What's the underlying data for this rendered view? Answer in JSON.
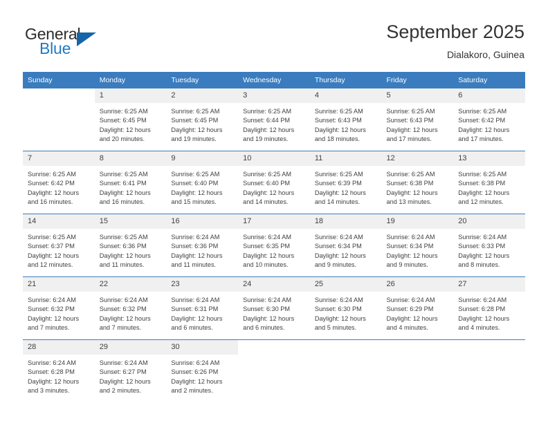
{
  "brand": {
    "name_part1": "General",
    "name_part2": "Blue",
    "triangle_color": "#1565a8",
    "blue_color": "#1f7ac4"
  },
  "header": {
    "title": "September 2025",
    "subtitle": "Dialakoro, Guinea"
  },
  "theme": {
    "header_bg": "#3a7cbe",
    "daynum_bg": "#f0f0f0",
    "text": "#3f3f3f"
  },
  "calendar": {
    "weekday_headers": [
      "Sunday",
      "Monday",
      "Tuesday",
      "Wednesday",
      "Thursday",
      "Friday",
      "Saturday"
    ],
    "weeks": [
      [
        {
          "day": "",
          "empty": true,
          "sunrise": "",
          "sunset": "",
          "daylight_line1": "",
          "daylight_line2": ""
        },
        {
          "day": "1",
          "empty": false,
          "sunrise": "Sunrise: 6:25 AM",
          "sunset": "Sunset: 6:45 PM",
          "daylight_line1": "Daylight: 12 hours",
          "daylight_line2": "and 20 minutes."
        },
        {
          "day": "2",
          "empty": false,
          "sunrise": "Sunrise: 6:25 AM",
          "sunset": "Sunset: 6:45 PM",
          "daylight_line1": "Daylight: 12 hours",
          "daylight_line2": "and 19 minutes."
        },
        {
          "day": "3",
          "empty": false,
          "sunrise": "Sunrise: 6:25 AM",
          "sunset": "Sunset: 6:44 PM",
          "daylight_line1": "Daylight: 12 hours",
          "daylight_line2": "and 19 minutes."
        },
        {
          "day": "4",
          "empty": false,
          "sunrise": "Sunrise: 6:25 AM",
          "sunset": "Sunset: 6:43 PM",
          "daylight_line1": "Daylight: 12 hours",
          "daylight_line2": "and 18 minutes."
        },
        {
          "day": "5",
          "empty": false,
          "sunrise": "Sunrise: 6:25 AM",
          "sunset": "Sunset: 6:43 PM",
          "daylight_line1": "Daylight: 12 hours",
          "daylight_line2": "and 17 minutes."
        },
        {
          "day": "6",
          "empty": false,
          "sunrise": "Sunrise: 6:25 AM",
          "sunset": "Sunset: 6:42 PM",
          "daylight_line1": "Daylight: 12 hours",
          "daylight_line2": "and 17 minutes."
        }
      ],
      [
        {
          "day": "7",
          "empty": false,
          "sunrise": "Sunrise: 6:25 AM",
          "sunset": "Sunset: 6:42 PM",
          "daylight_line1": "Daylight: 12 hours",
          "daylight_line2": "and 16 minutes."
        },
        {
          "day": "8",
          "empty": false,
          "sunrise": "Sunrise: 6:25 AM",
          "sunset": "Sunset: 6:41 PM",
          "daylight_line1": "Daylight: 12 hours",
          "daylight_line2": "and 16 minutes."
        },
        {
          "day": "9",
          "empty": false,
          "sunrise": "Sunrise: 6:25 AM",
          "sunset": "Sunset: 6:40 PM",
          "daylight_line1": "Daylight: 12 hours",
          "daylight_line2": "and 15 minutes."
        },
        {
          "day": "10",
          "empty": false,
          "sunrise": "Sunrise: 6:25 AM",
          "sunset": "Sunset: 6:40 PM",
          "daylight_line1": "Daylight: 12 hours",
          "daylight_line2": "and 14 minutes."
        },
        {
          "day": "11",
          "empty": false,
          "sunrise": "Sunrise: 6:25 AM",
          "sunset": "Sunset: 6:39 PM",
          "daylight_line1": "Daylight: 12 hours",
          "daylight_line2": "and 14 minutes."
        },
        {
          "day": "12",
          "empty": false,
          "sunrise": "Sunrise: 6:25 AM",
          "sunset": "Sunset: 6:38 PM",
          "daylight_line1": "Daylight: 12 hours",
          "daylight_line2": "and 13 minutes."
        },
        {
          "day": "13",
          "empty": false,
          "sunrise": "Sunrise: 6:25 AM",
          "sunset": "Sunset: 6:38 PM",
          "daylight_line1": "Daylight: 12 hours",
          "daylight_line2": "and 12 minutes."
        }
      ],
      [
        {
          "day": "14",
          "empty": false,
          "sunrise": "Sunrise: 6:25 AM",
          "sunset": "Sunset: 6:37 PM",
          "daylight_line1": "Daylight: 12 hours",
          "daylight_line2": "and 12 minutes."
        },
        {
          "day": "15",
          "empty": false,
          "sunrise": "Sunrise: 6:25 AM",
          "sunset": "Sunset: 6:36 PM",
          "daylight_line1": "Daylight: 12 hours",
          "daylight_line2": "and 11 minutes."
        },
        {
          "day": "16",
          "empty": false,
          "sunrise": "Sunrise: 6:24 AM",
          "sunset": "Sunset: 6:36 PM",
          "daylight_line1": "Daylight: 12 hours",
          "daylight_line2": "and 11 minutes."
        },
        {
          "day": "17",
          "empty": false,
          "sunrise": "Sunrise: 6:24 AM",
          "sunset": "Sunset: 6:35 PM",
          "daylight_line1": "Daylight: 12 hours",
          "daylight_line2": "and 10 minutes."
        },
        {
          "day": "18",
          "empty": false,
          "sunrise": "Sunrise: 6:24 AM",
          "sunset": "Sunset: 6:34 PM",
          "daylight_line1": "Daylight: 12 hours",
          "daylight_line2": "and 9 minutes."
        },
        {
          "day": "19",
          "empty": false,
          "sunrise": "Sunrise: 6:24 AM",
          "sunset": "Sunset: 6:34 PM",
          "daylight_line1": "Daylight: 12 hours",
          "daylight_line2": "and 9 minutes."
        },
        {
          "day": "20",
          "empty": false,
          "sunrise": "Sunrise: 6:24 AM",
          "sunset": "Sunset: 6:33 PM",
          "daylight_line1": "Daylight: 12 hours",
          "daylight_line2": "and 8 minutes."
        }
      ],
      [
        {
          "day": "21",
          "empty": false,
          "sunrise": "Sunrise: 6:24 AM",
          "sunset": "Sunset: 6:32 PM",
          "daylight_line1": "Daylight: 12 hours",
          "daylight_line2": "and 7 minutes."
        },
        {
          "day": "22",
          "empty": false,
          "sunrise": "Sunrise: 6:24 AM",
          "sunset": "Sunset: 6:32 PM",
          "daylight_line1": "Daylight: 12 hours",
          "daylight_line2": "and 7 minutes."
        },
        {
          "day": "23",
          "empty": false,
          "sunrise": "Sunrise: 6:24 AM",
          "sunset": "Sunset: 6:31 PM",
          "daylight_line1": "Daylight: 12 hours",
          "daylight_line2": "and 6 minutes."
        },
        {
          "day": "24",
          "empty": false,
          "sunrise": "Sunrise: 6:24 AM",
          "sunset": "Sunset: 6:30 PM",
          "daylight_line1": "Daylight: 12 hours",
          "daylight_line2": "and 6 minutes."
        },
        {
          "day": "25",
          "empty": false,
          "sunrise": "Sunrise: 6:24 AM",
          "sunset": "Sunset: 6:30 PM",
          "daylight_line1": "Daylight: 12 hours",
          "daylight_line2": "and 5 minutes."
        },
        {
          "day": "26",
          "empty": false,
          "sunrise": "Sunrise: 6:24 AM",
          "sunset": "Sunset: 6:29 PM",
          "daylight_line1": "Daylight: 12 hours",
          "daylight_line2": "and 4 minutes."
        },
        {
          "day": "27",
          "empty": false,
          "sunrise": "Sunrise: 6:24 AM",
          "sunset": "Sunset: 6:28 PM",
          "daylight_line1": "Daylight: 12 hours",
          "daylight_line2": "and 4 minutes."
        }
      ],
      [
        {
          "day": "28",
          "empty": false,
          "sunrise": "Sunrise: 6:24 AM",
          "sunset": "Sunset: 6:28 PM",
          "daylight_line1": "Daylight: 12 hours",
          "daylight_line2": "and 3 minutes."
        },
        {
          "day": "29",
          "empty": false,
          "sunrise": "Sunrise: 6:24 AM",
          "sunset": "Sunset: 6:27 PM",
          "daylight_line1": "Daylight: 12 hours",
          "daylight_line2": "and 2 minutes."
        },
        {
          "day": "30",
          "empty": false,
          "sunrise": "Sunrise: 6:24 AM",
          "sunset": "Sunset: 6:26 PM",
          "daylight_line1": "Daylight: 12 hours",
          "daylight_line2": "and 2 minutes."
        },
        {
          "day": "",
          "empty": true,
          "sunrise": "",
          "sunset": "",
          "daylight_line1": "",
          "daylight_line2": ""
        },
        {
          "day": "",
          "empty": true,
          "sunrise": "",
          "sunset": "",
          "daylight_line1": "",
          "daylight_line2": ""
        },
        {
          "day": "",
          "empty": true,
          "sunrise": "",
          "sunset": "",
          "daylight_line1": "",
          "daylight_line2": ""
        },
        {
          "day": "",
          "empty": true,
          "sunrise": "",
          "sunset": "",
          "daylight_line1": "",
          "daylight_line2": ""
        }
      ]
    ]
  }
}
